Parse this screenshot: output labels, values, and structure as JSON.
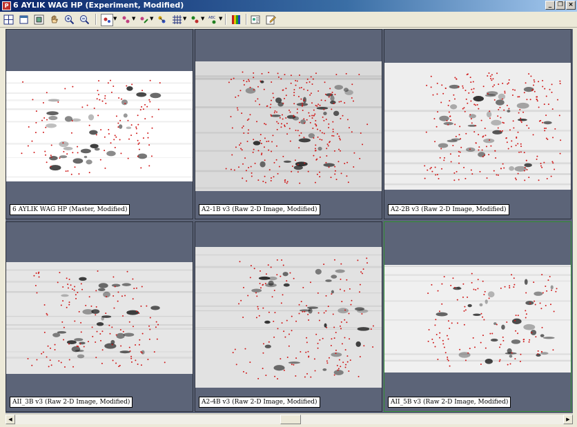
{
  "window": {
    "title": "6 AYLIK WAG HP (Experiment, Modified)",
    "app_icon": "progenesis-app-icon",
    "controls": [
      "minimize-icon",
      "restore-icon",
      "close-icon"
    ]
  },
  "toolbar": {
    "buttons": [
      "grid-layout-icon",
      "single-view-icon",
      "fit-view-icon",
      "pan-hand-icon",
      "zoom-in-icon",
      "zoom-out-icon",
      "spot-select-icon",
      "spot-detect-icon",
      "spot-edit-icon",
      "spot-match-icon",
      "grid-overlay-icon",
      "landmark-icon",
      "label-abc-icon",
      "color-bars-icon",
      "image-properties-icon",
      "edit-notes-icon"
    ]
  },
  "panels": [
    {
      "label": "6 AYLIK WAG HP (Master, Modified)",
      "selected": false
    },
    {
      "label": "A2-1B v3 (Raw 2-D Image, Modified)",
      "selected": false
    },
    {
      "label": "A2-2B v3 (Raw 2-D Image, Modified)",
      "selected": false
    },
    {
      "label": "AII_3B v3 (Raw 2-D Image, Modified)",
      "selected": false
    },
    {
      "label": "A2-4B v3 (Raw 2-D Image, Modified)",
      "selected": false
    },
    {
      "label": "AII_5B v3 (Raw 2-D Image, Modified)",
      "selected": true
    }
  ],
  "colors": {
    "background": "#5c6478",
    "spot_marker": "#d01818",
    "selected_border": "#2f8f2f"
  }
}
